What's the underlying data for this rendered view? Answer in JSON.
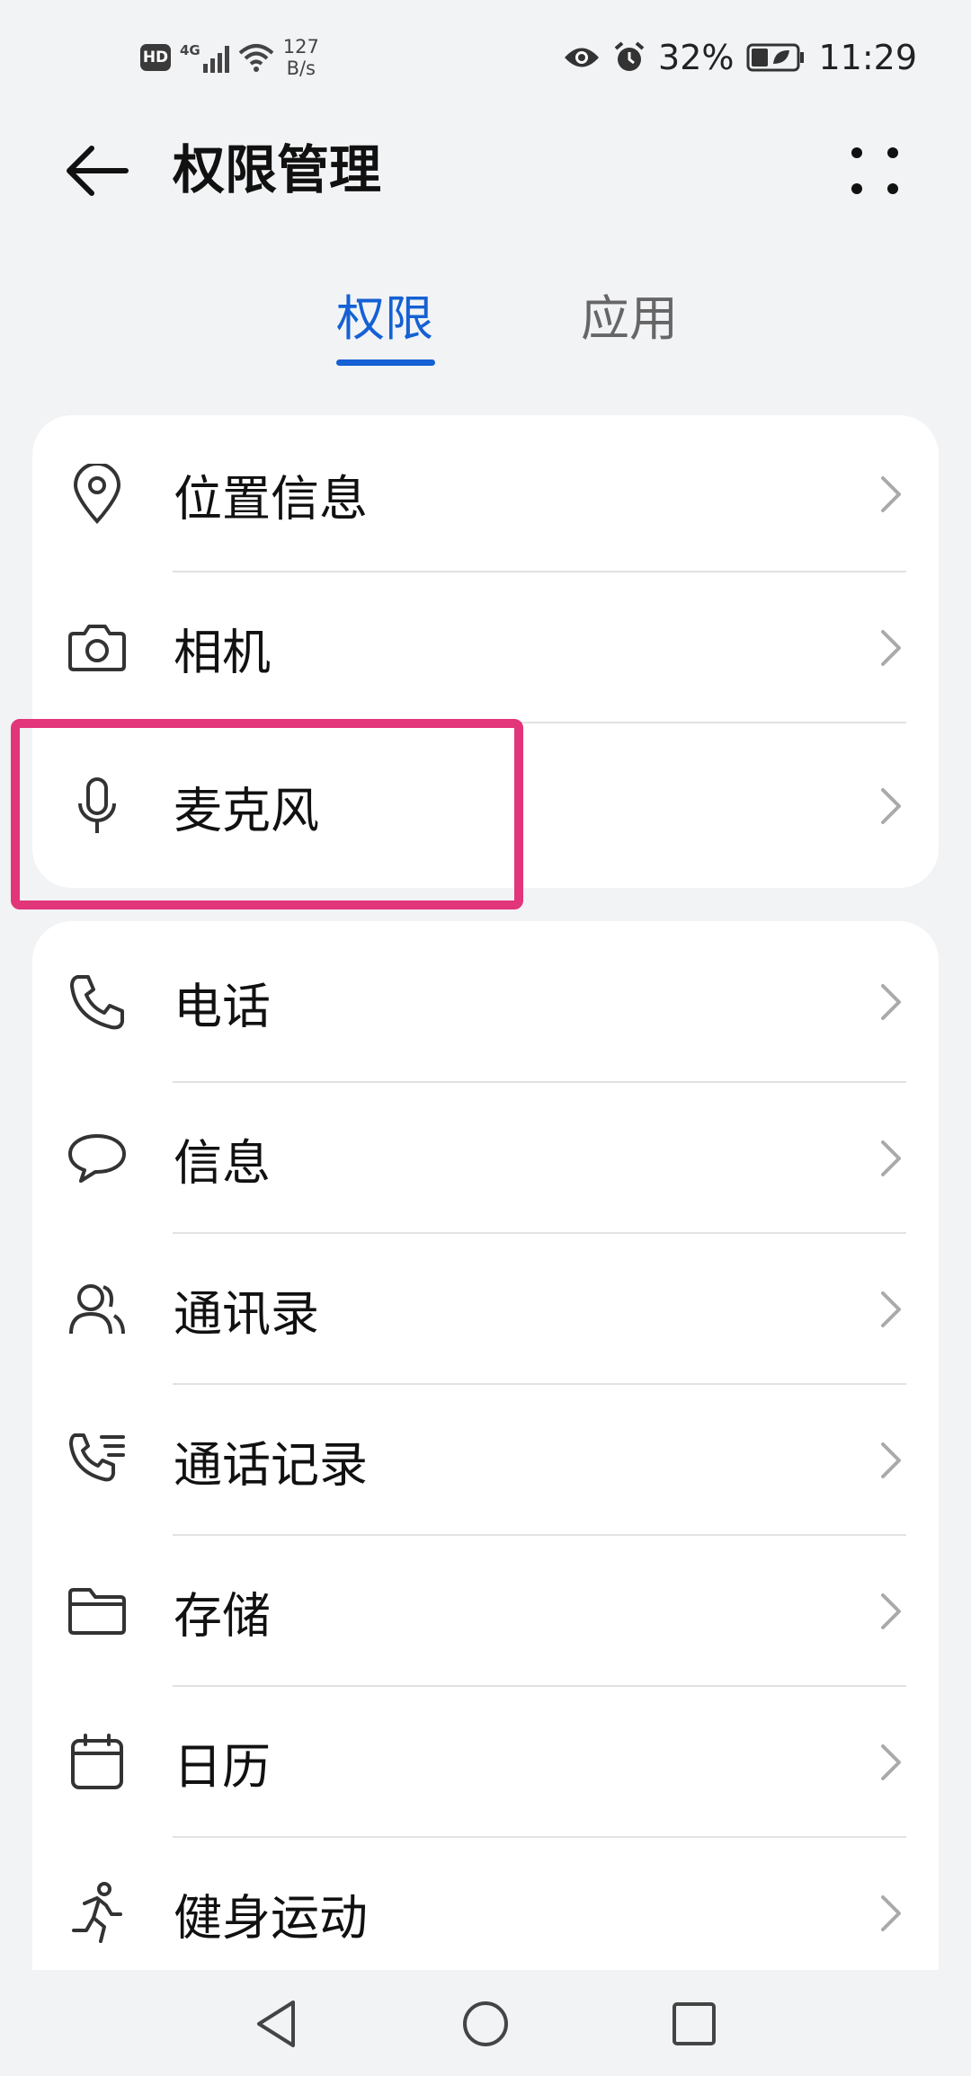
{
  "status_bar": {
    "hd": "HD",
    "network": "4G",
    "speed_value": "127",
    "speed_unit": "B/s",
    "battery": "32%",
    "time": "11:29",
    "icons": [
      "eye-comfort-icon",
      "alarm-icon",
      "battery-icon"
    ]
  },
  "header": {
    "title": "权限管理",
    "back_icon": "arrow-left-icon",
    "more_icon": "more-vertical-icon"
  },
  "tabs": [
    {
      "label": "权限",
      "active": true
    },
    {
      "label": "应用",
      "active": false
    }
  ],
  "accent_color": "#1560d4",
  "highlight_color": "#e2357a",
  "group1": [
    {
      "label": "位置信息",
      "icon": "location-pin-icon"
    },
    {
      "label": "相机",
      "icon": "camera-icon"
    },
    {
      "label": "麦克风",
      "icon": "microphone-icon"
    }
  ],
  "group2": [
    {
      "label": "电话",
      "icon": "phone-icon"
    },
    {
      "label": "信息",
      "icon": "message-bubble-icon"
    },
    {
      "label": "通讯录",
      "icon": "contacts-icon"
    },
    {
      "label": "通话记录",
      "icon": "call-log-icon"
    },
    {
      "label": "存储",
      "icon": "folder-icon"
    },
    {
      "label": "日历",
      "icon": "calendar-icon"
    },
    {
      "label": "健身运动",
      "icon": "running-icon"
    }
  ],
  "nav_bar": [
    "back-triangle-icon",
    "home-circle-icon",
    "recents-square-icon"
  ]
}
